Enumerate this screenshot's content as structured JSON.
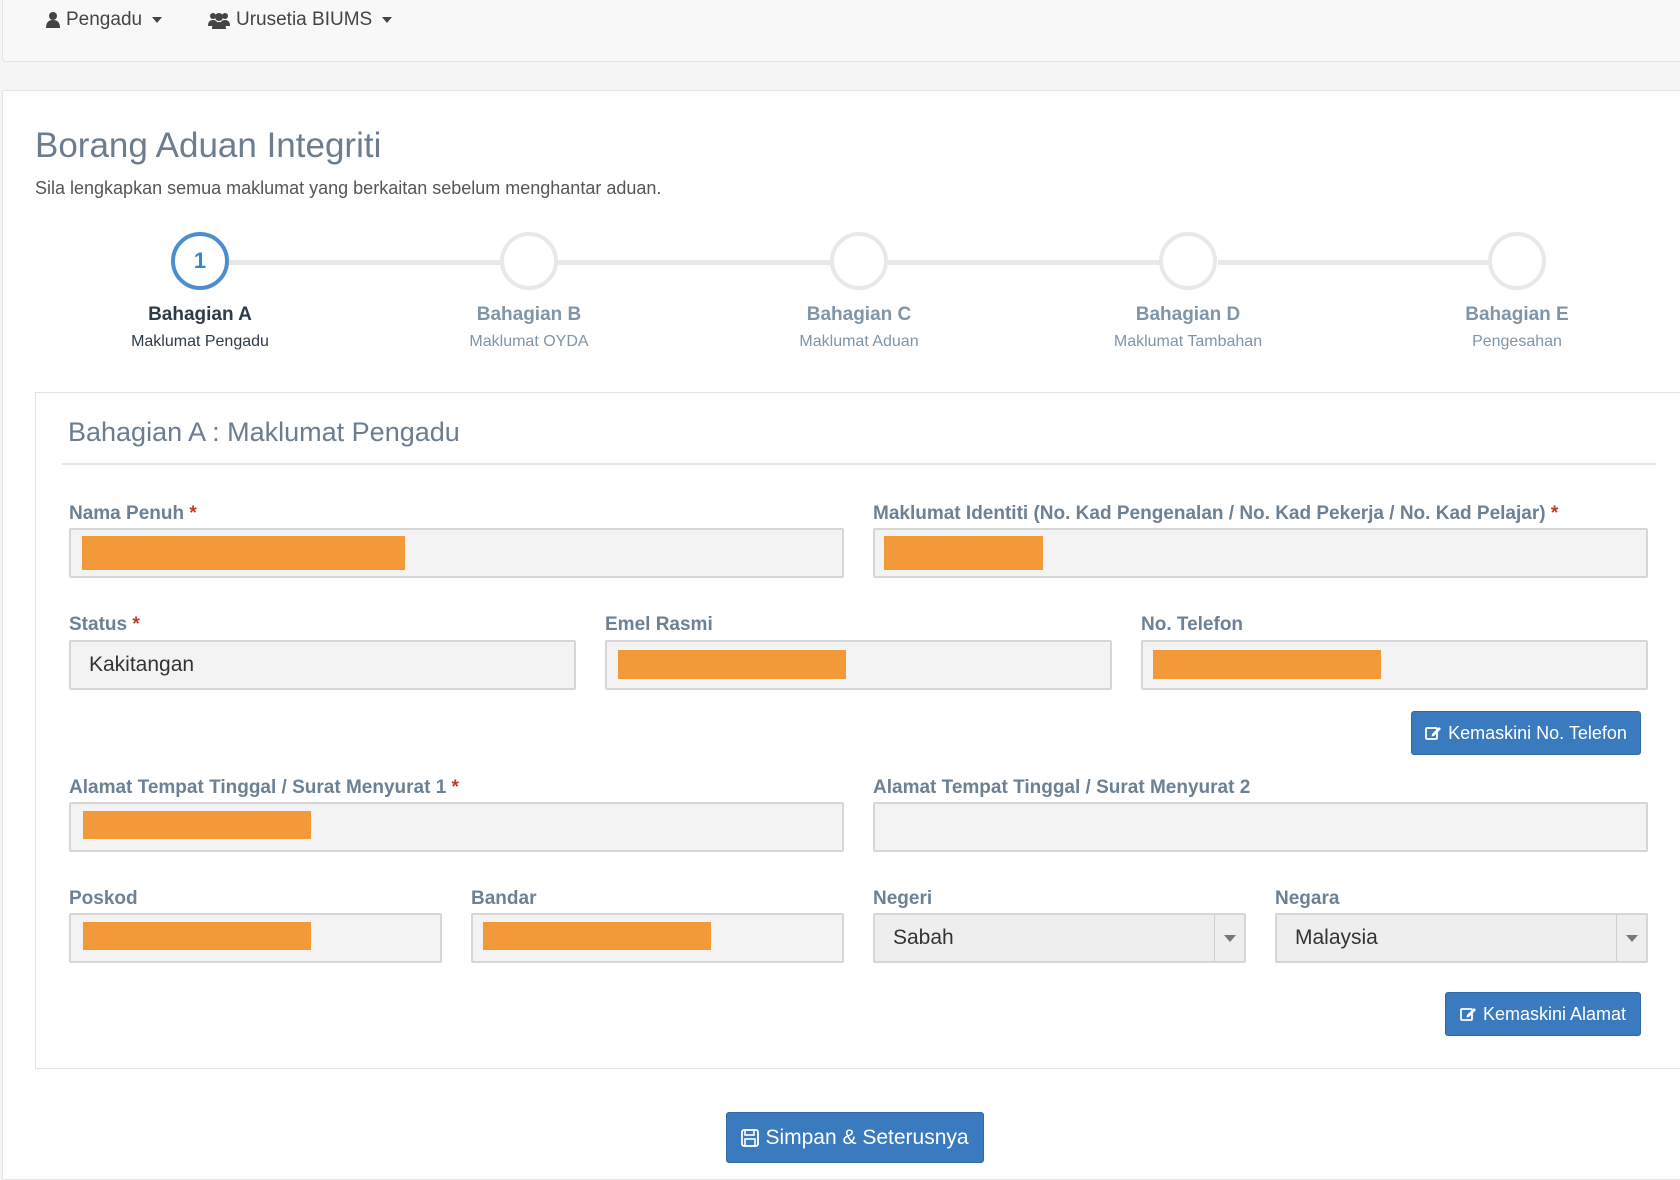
{
  "nav": {
    "items": [
      {
        "label": "Pengadu",
        "icon": "user-icon"
      },
      {
        "label": "Urusetia BIUMS",
        "icon": "users-icon"
      }
    ]
  },
  "page": {
    "title": "Borang Aduan Integriti",
    "subtitle": "Sila lengkapkan semua maklumat yang berkaitan sebelum menghantar aduan."
  },
  "steps": [
    {
      "number": "1",
      "title": "Bahagian A",
      "desc": "Maklumat Pengadu",
      "active": true
    },
    {
      "number": "",
      "title": "Bahagian B",
      "desc": "Maklumat OYDA",
      "active": false
    },
    {
      "number": "",
      "title": "Bahagian C",
      "desc": "Maklumat Aduan",
      "active": false
    },
    {
      "number": "",
      "title": "Bahagian D",
      "desc": "Maklumat Tambahan",
      "active": false
    },
    {
      "number": "",
      "title": "Bahagian E",
      "desc": "Pengesahan",
      "active": false
    }
  ],
  "section": {
    "title": "Bahagian A : Maklumat Pengadu"
  },
  "fields": {
    "nama_penuh": {
      "label": "Nama Penuh",
      "required": "*",
      "value": ""
    },
    "identiti": {
      "label": "Maklumat Identiti (No. Kad Pengenalan / No. Kad Pekerja / No. Kad Pelajar)",
      "required": "*",
      "value": ""
    },
    "status": {
      "label": "Status",
      "required": "*",
      "value": "Kakitangan"
    },
    "emel": {
      "label": "Emel Rasmi",
      "value": ""
    },
    "telefon": {
      "label": "No. Telefon",
      "value": ""
    },
    "alamat1": {
      "label": "Alamat Tempat Tinggal / Surat Menyurat 1",
      "required": "*",
      "value": ""
    },
    "alamat2": {
      "label": "Alamat Tempat Tinggal / Surat Menyurat 2",
      "value": ""
    },
    "poskod": {
      "label": "Poskod",
      "value": ""
    },
    "bandar": {
      "label": "Bandar",
      "value": ""
    },
    "negeri": {
      "label": "Negeri",
      "value": "Sabah"
    },
    "negara": {
      "label": "Negara",
      "value": "Malaysia"
    }
  },
  "buttons": {
    "kemaskini_telefon": "Kemaskini No. Telefon",
    "kemaskini_alamat": "Kemaskini Alamat",
    "simpan": "Simpan & Seterusnya"
  },
  "colors": {
    "primary": "#3a7bbf",
    "redaction": "#f29a3a",
    "title": "#6b7d8e"
  }
}
